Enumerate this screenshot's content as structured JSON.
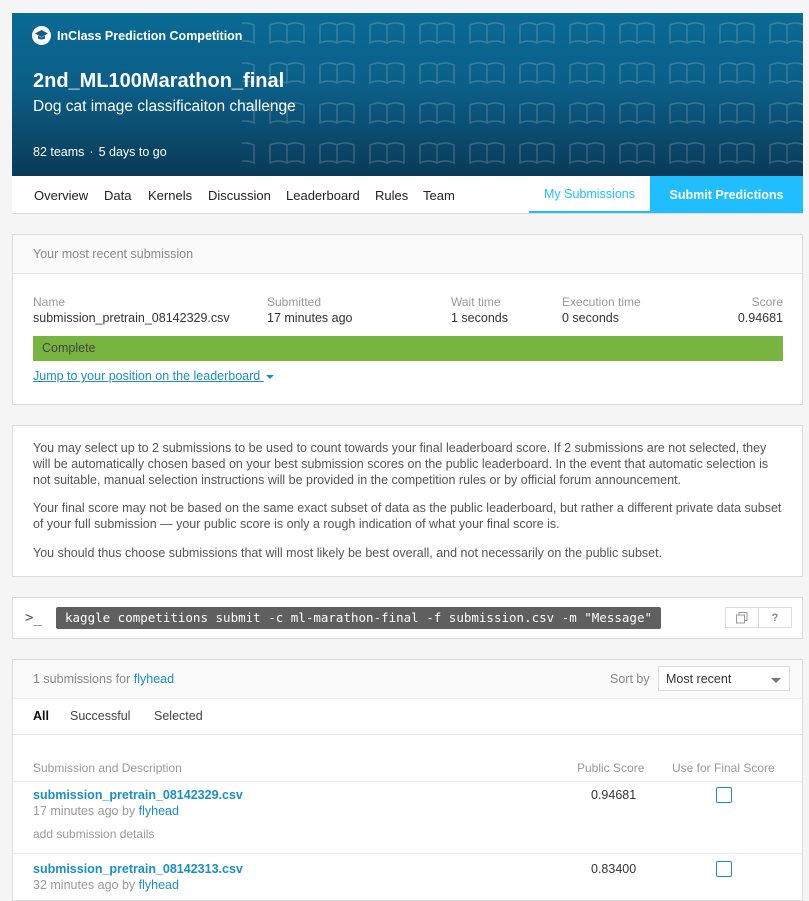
{
  "header": {
    "badge": "InClass Prediction Competition",
    "title": "2nd_ML100Marathon_final",
    "subtitle": "Dog cat image classificaiton challenge",
    "teams": "82 teams",
    "separator": "·",
    "deadline": "5 days to go"
  },
  "nav": {
    "tabs": [
      "Overview",
      "Data",
      "Kernels",
      "Discussion",
      "Leaderboard",
      "Rules",
      "Team"
    ],
    "my_submissions": "My Submissions",
    "submit": "Submit Predictions"
  },
  "recent": {
    "heading": "Your most recent submission",
    "labels": {
      "name": "Name",
      "submitted": "Submitted",
      "wait": "Wait time",
      "exec": "Execution time",
      "score": "Score"
    },
    "values": {
      "name": "submission_pretrain_08142329.csv",
      "submitted": "17 minutes ago",
      "wait": "1 seconds",
      "exec": "0 seconds",
      "score": "0.94681"
    },
    "status": "Complete",
    "status_progress": 1.0,
    "jump": "Jump to your position on the leaderboard"
  },
  "info": {
    "p1": "You may select up to 2 submissions to be used to count towards your final leaderboard score. If 2 submissions are not selected, they will be automatically chosen based on your best submission scores on the public leaderboard. In the event that automatic selection is not suitable, manual selection instructions will be provided in the competition rules or by official forum announcement.",
    "p2": "Your final score may not be based on the same exact subset of data as the public leaderboard, but rather a different private data subset of your full submission — your public score is only a rough indication of what your final score is.",
    "p3": "You should thus choose submissions that will most likely be best overall, and not necessarily on the public subset."
  },
  "cli": {
    "prompt_icon": "terminal-icon",
    "command": "kaggle competitions submit -c ml-marathon-final -f submission.csv -m \"Message\"",
    "copy_icon": "copy-icon",
    "help": "?"
  },
  "submissions": {
    "count_prefix": "1 submissions for",
    "user": "flyhead",
    "sort_label": "Sort by",
    "sort_value": "Most recent",
    "filters": [
      "All",
      "Successful",
      "Selected"
    ],
    "columns": {
      "desc": "Submission and Description",
      "public": "Public Score",
      "final": "Use for Final Score"
    },
    "rows": [
      {
        "file": "submission_pretrain_08142329.csv",
        "when": "17 minutes ago by",
        "user": "flyhead",
        "details": "add submission details",
        "score": "0.94681"
      },
      {
        "file": "submission_pretrain_08142313.csv",
        "when": "32 minutes ago by",
        "user": "flyhead",
        "details": "",
        "score": "0.83400"
      }
    ]
  }
}
